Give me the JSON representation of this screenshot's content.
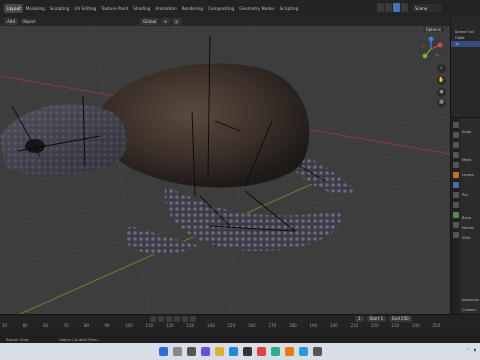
{
  "topbar": {
    "workspace_tabs": [
      "Layout",
      "Modeling",
      "Sculpting",
      "UV Editing",
      "Texture Paint",
      "Shading",
      "Animation",
      "Rendering",
      "Compositing",
      "Geometry Nodes",
      "Scripting"
    ],
    "active_index": 0,
    "scene_label": "Scene"
  },
  "viewport_header": {
    "mode": "Add",
    "object_menu": "Object",
    "orientation": "Global",
    "options_label": "Options"
  },
  "outliner": {
    "rows": [
      "Scene Col",
      "Colle",
      "Tu"
    ]
  },
  "properties": {
    "labels": [
      "Ambi",
      "Mesh",
      "Layers",
      "Pro",
      "Bone",
      "Motion",
      "Visib",
      "Instances",
      "Custom"
    ]
  },
  "timeline": {
    "ticks": [
      "10",
      "80",
      "60",
      "70",
      "80",
      "90",
      "100",
      "110",
      "120",
      "130",
      "140",
      "150",
      "160",
      "170",
      "180",
      "190",
      "200",
      "210",
      "220",
      "230",
      "240",
      "250"
    ],
    "start_label": "Start",
    "start_value": "1",
    "end_label": "End",
    "end_value": "250",
    "current_frame": "1"
  },
  "status": {
    "left": "Rotate View",
    "center": "Object Context Menu"
  },
  "colors": {
    "accent": "#4772b3",
    "viewport_bg": "#3d3d3d",
    "axis_x": "#a0393e",
    "axis_y": "#6a9a2d",
    "taskbar": "#d9dde6"
  }
}
